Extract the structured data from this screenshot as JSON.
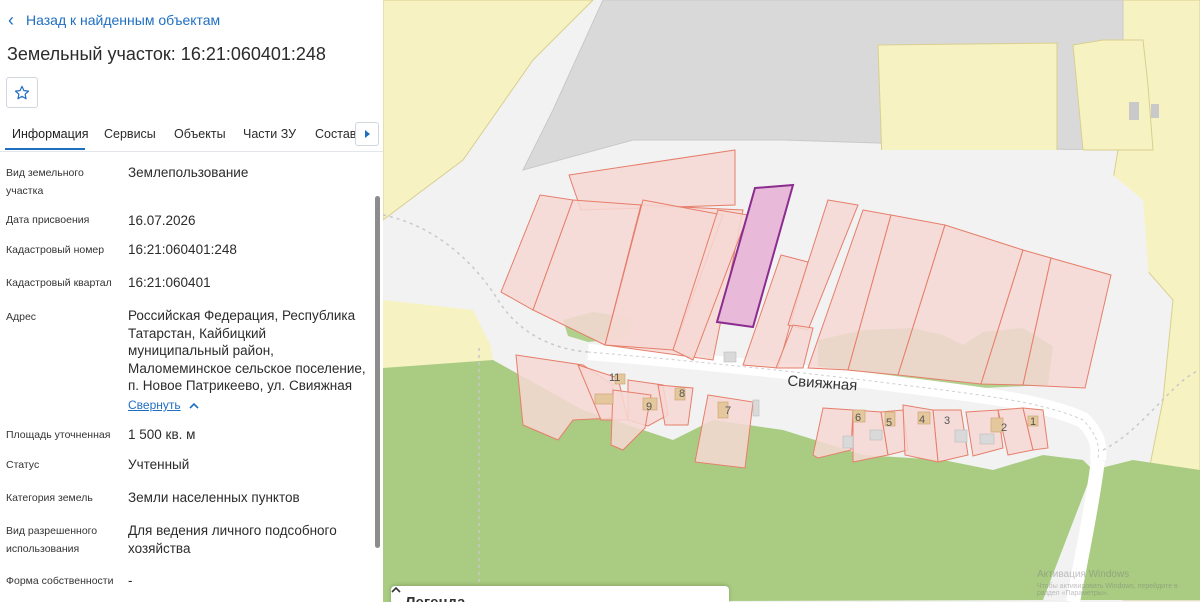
{
  "nav": {
    "back_label": "Назад к найденным объектам"
  },
  "page": {
    "title": "Земельный участок: 16:21:060401:248"
  },
  "tabs": [
    {
      "label": "Информация"
    },
    {
      "label": "Сервисы"
    },
    {
      "label": "Объекты"
    },
    {
      "label": "Части ЗУ"
    },
    {
      "label": "Состав"
    }
  ],
  "fields": {
    "type": {
      "label": "Вид земельного участка",
      "value": "Землепользование"
    },
    "date": {
      "label": "Дата присвоения",
      "value": "16.07.2026"
    },
    "cadastral_number": {
      "label": "Кадастровый номер",
      "value": "16:21:060401:248"
    },
    "cadastral_quarter": {
      "label": "Кадастровый квартал",
      "value": "16:21:060401"
    },
    "address": {
      "label": "Адрес",
      "value": "Российская Федерация, Республика Татарстан, Кайбицкий муниципальный район, Маломеминское сельское поселение, п. Новое Патрикеево, ул. Свияжная",
      "collapse_label": "Свернуть"
    },
    "area": {
      "label": "Площадь уточненная",
      "value": "1 500 кв. м"
    },
    "status": {
      "label": "Статус",
      "value": "Учтенный"
    },
    "category": {
      "label": "Категория земель",
      "value": "Земли населенных пунктов"
    },
    "permitted_use": {
      "label": "Вид разрешенного использования",
      "value": "Для ведения личного подсобного хозяйства"
    },
    "ownership": {
      "label": "Форма собственности",
      "value": "-"
    }
  },
  "map": {
    "street_label": "Свияжная",
    "house_numbers": [
      "11",
      "9",
      "8",
      "7",
      "6",
      "5",
      "4",
      "3",
      "2",
      "1"
    ],
    "legend_title": "Легенда",
    "watermark": "Активация Windows",
    "watermark_sub": "Чтобы активировать Windows, перейдите в раздел «Параметры».",
    "colors": {
      "yellow_zone": "#f7f2c2",
      "grey_zone": "#d9d9d9",
      "green_zone": "#a9cc82",
      "parcel_fill": "#f6d8d4",
      "parcel_stroke": "#e67e6b",
      "selected_fill": "#e8b9d9",
      "selected_stroke": "#8b2d8f"
    }
  },
  "icons": {
    "back": "chevron-left-icon",
    "favorite": "star-icon",
    "tab_scroll": "caret-right-icon",
    "collapse": "chevron-up-icon",
    "legend": "chevron-up-icon"
  }
}
